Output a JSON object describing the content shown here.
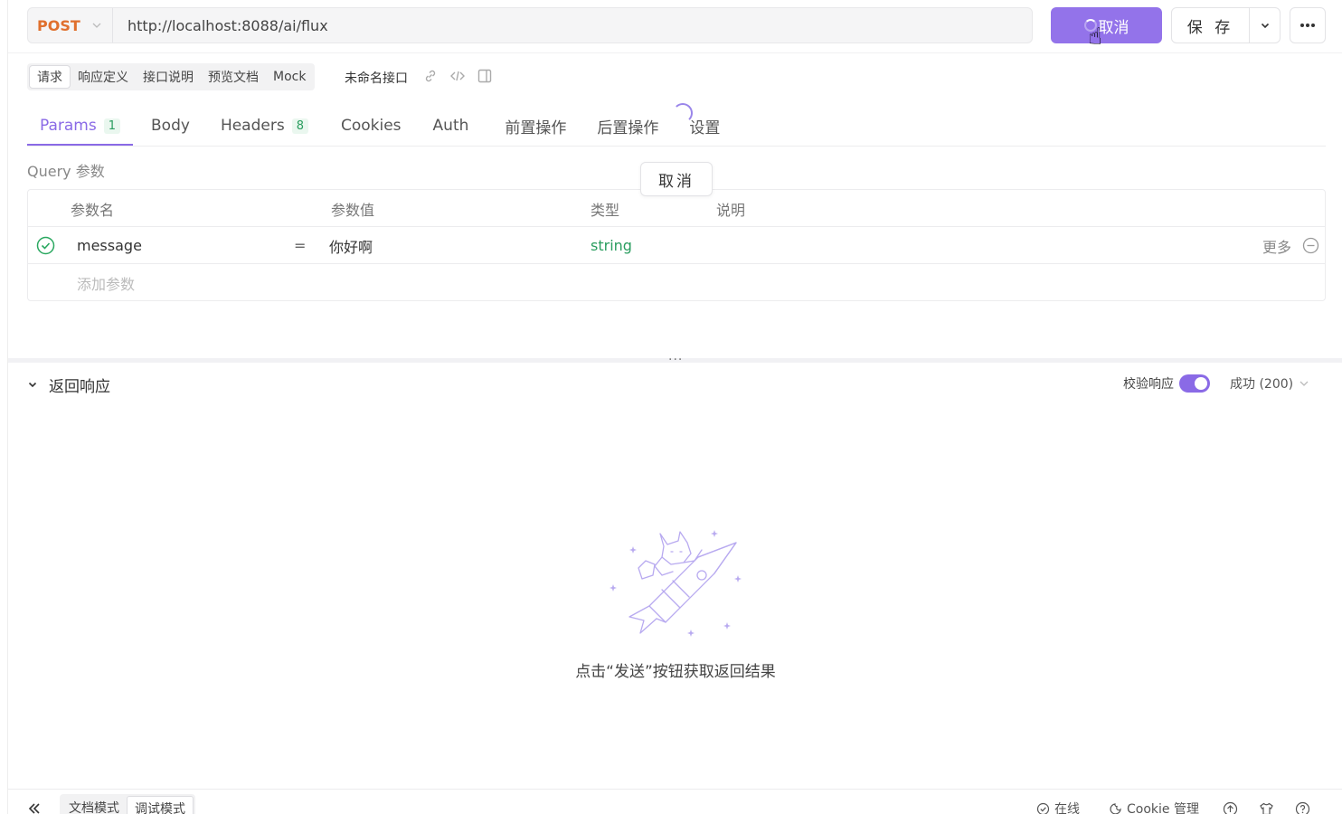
{
  "request": {
    "method": "POST",
    "url": "http://localhost:8088/ai/flux",
    "cancel_label": "取消",
    "save_label": "保 存"
  },
  "subtabs": [
    {
      "label": "请求",
      "active": true
    },
    {
      "label": "响应定义",
      "active": false
    },
    {
      "label": "接口说明",
      "active": false
    },
    {
      "label": "预览文档",
      "active": false
    },
    {
      "label": "Mock",
      "active": false
    }
  ],
  "api_name": "未命名接口",
  "tabs": [
    {
      "label": "Params",
      "badge": "1",
      "active": true
    },
    {
      "label": "Body",
      "badge": "",
      "active": false
    },
    {
      "label": "Headers",
      "badge": "8",
      "active": false
    },
    {
      "label": "Cookies",
      "badge": "",
      "active": false
    },
    {
      "label": "Auth",
      "badge": "",
      "active": false
    },
    {
      "label": "前置操作",
      "badge": "",
      "active": false
    },
    {
      "label": "后置操作",
      "badge": "",
      "active": false
    },
    {
      "label": "设置",
      "badge": "",
      "active": false
    }
  ],
  "query": {
    "title": "Query 参数",
    "tooltip": "取消",
    "columns": [
      "参数名",
      "参数值",
      "类型",
      "说明"
    ],
    "rows": [
      {
        "name": "message",
        "op": "=",
        "value": "你好啊",
        "type": "string",
        "more": "更多"
      }
    ],
    "add_placeholder": "添加参数"
  },
  "response": {
    "title": "返回响应",
    "verify_label": "校验响应",
    "verify_enabled": true,
    "status": "成功 (200)",
    "empty_text": "点击“发送”按钮获取返回结果"
  },
  "footer": {
    "modes": [
      {
        "label": "文档模式",
        "active": false
      },
      {
        "label": "调试模式",
        "active": true
      }
    ],
    "online": "在线",
    "cookie": "Cookie 管理"
  },
  "colors": {
    "accent": "#8a6ae6",
    "method": "#e0702e",
    "type": "#2a9d5f"
  }
}
